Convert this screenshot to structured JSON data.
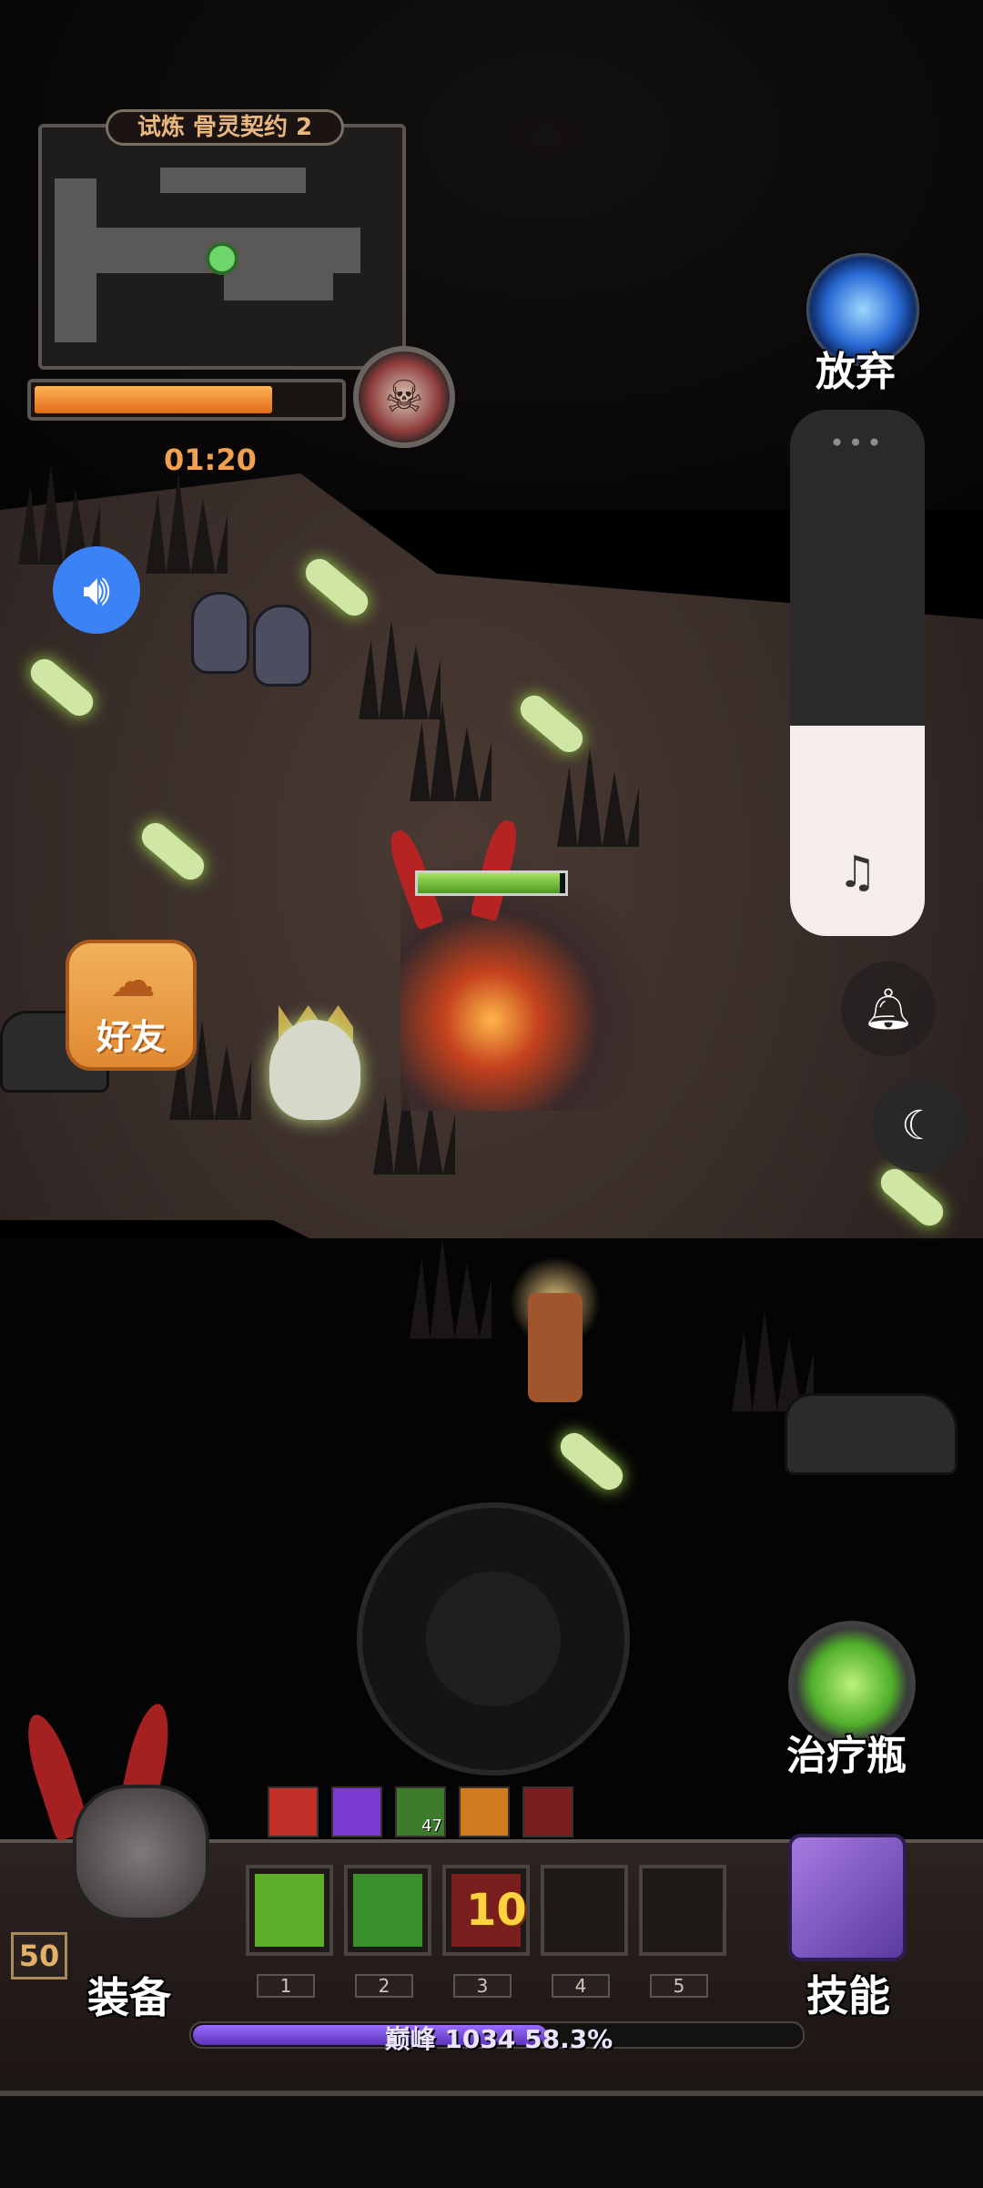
{
  "minimap": {
    "title": "试炼 骨灵契约 2"
  },
  "timer": {
    "text": "01:20",
    "progress": 0.78
  },
  "abandon": {
    "label": "放弃"
  },
  "volume": {
    "level": 0.4,
    "dots": "•••"
  },
  "friends": {
    "label": "好友"
  },
  "hero": {
    "hp": 0.96
  },
  "potion": {
    "label": "治疗瓶"
  },
  "buffs": [
    {
      "color": "#c2302a"
    },
    {
      "color": "#7a3ad1"
    },
    {
      "color": "#3e7a2b",
      "count": "47"
    },
    {
      "color": "#d07b1e"
    },
    {
      "color": "#7a1f1f"
    }
  ],
  "player": {
    "level": "50",
    "equip_label": "装备"
  },
  "skill_slots": [
    {
      "index": "1",
      "color": "#5fae2a"
    },
    {
      "index": "2",
      "color": "#3a8f2a"
    },
    {
      "index": "3",
      "color": "#7a1d1d",
      "number": "10"
    },
    {
      "index": "4",
      "color": ""
    },
    {
      "index": "5",
      "color": ""
    }
  ],
  "skills": {
    "label": "技能"
  },
  "exp": {
    "text": "巅峰 1034 58.3%",
    "progress": 0.583
  }
}
